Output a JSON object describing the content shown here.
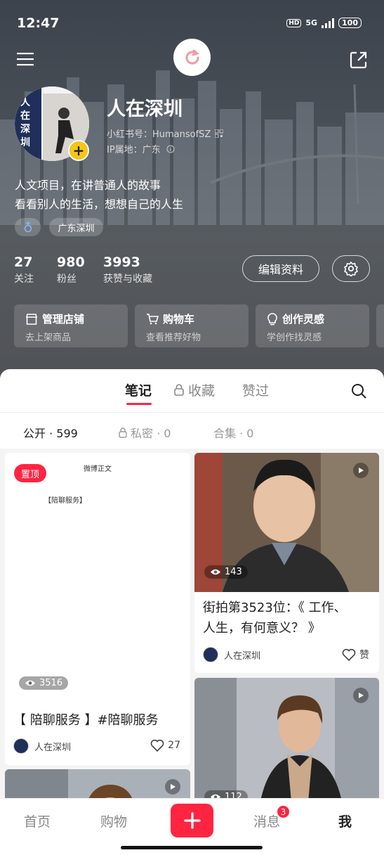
{
  "status_bar": {
    "time": "12:47",
    "hd": "HD",
    "signal": "5G",
    "battery": "100"
  },
  "profile": {
    "name": "人在深圳",
    "xhs_id": "小红书号：HumansofSZ",
    "ip_location": "IP属地：广东",
    "bio_line1": "人文项目，在讲普通人的故事",
    "bio_line2": "看看别人的生活，想想自己的人生",
    "gender_icon": "male-icon",
    "location_tag": "广东深圳",
    "avatar_text": "人在深圳"
  },
  "stats": [
    {
      "value": "27",
      "label": "关注"
    },
    {
      "value": "980",
      "label": "粉丝"
    },
    {
      "value": "3993",
      "label": "获赞与收藏"
    }
  ],
  "edit_profile_label": "编辑资料",
  "cards": [
    {
      "title": "管理店铺",
      "subtitle": "去上架商品",
      "icon": "store-icon"
    },
    {
      "title": "购物车",
      "subtitle": "查看推荐好物",
      "icon": "cart-icon"
    },
    {
      "title": "创作灵感",
      "subtitle": "学创作找灵感",
      "icon": "bulb-icon"
    }
  ],
  "tabs": [
    "笔记",
    "收藏",
    "赞过"
  ],
  "subtabs": [
    {
      "label": "公开 · 599"
    },
    {
      "label": "私密 · 0"
    },
    {
      "label": "合集 · 0"
    }
  ],
  "notes": [
    {
      "pinned": "置顶",
      "views": "3516",
      "title": "【 陪聊服务 】#陪聊服务",
      "author": "人在深圳",
      "likes": "27",
      "doc_header": "微博正文",
      "doc_heading": "【陪聊服务】"
    },
    {
      "views": "143",
      "title_line1": "街拍第3523位：《 工作、",
      "title_line2": "人生，有何意义？ 》",
      "author": "人在深圳",
      "likes": "赞"
    },
    {
      "views": "112"
    },
    {}
  ],
  "nav": {
    "home": "首页",
    "shop": "购物",
    "messages": "消息",
    "messages_badge": "3",
    "me": "我"
  },
  "colors": {
    "accent": "#ff2442",
    "gold": "#f5c518"
  }
}
